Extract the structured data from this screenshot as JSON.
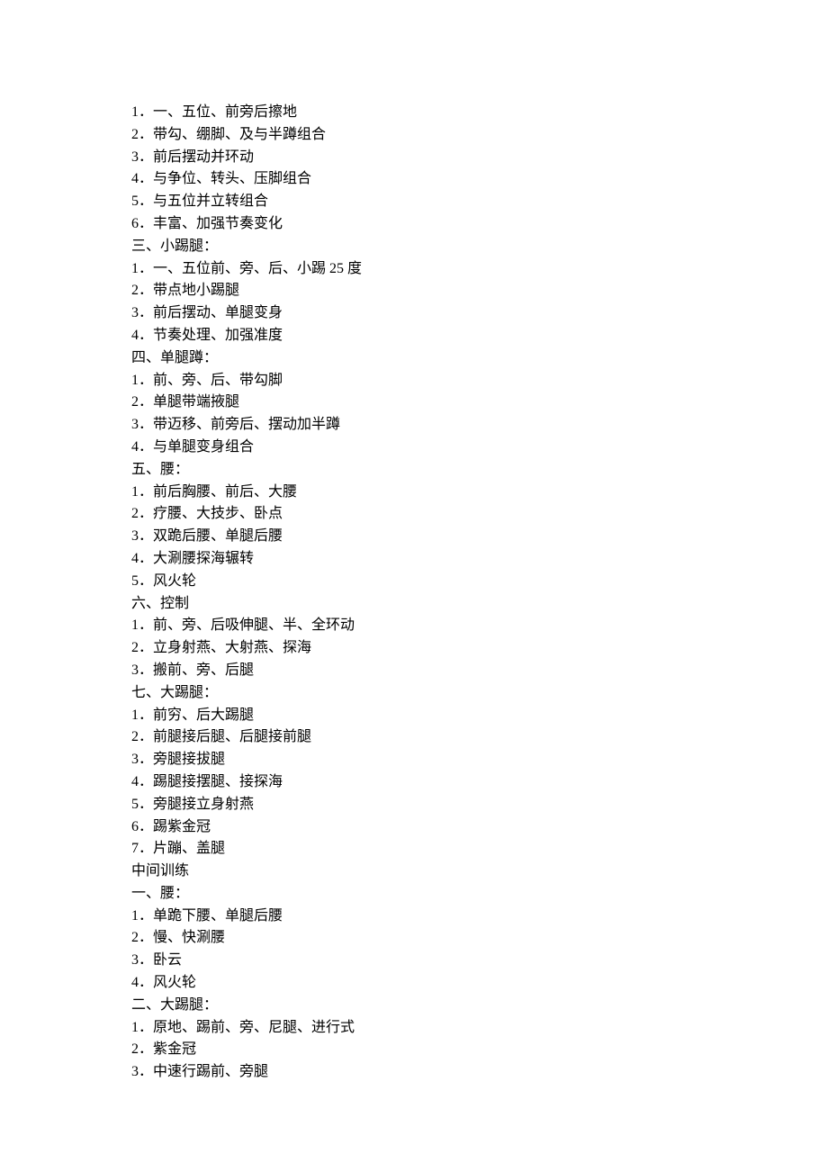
{
  "lines": [
    "1．一、五位、前旁后擦地",
    "2．带勾、绷脚、及与半蹲组合",
    "3．前后摆动并环动",
    "4．与争位、转头、压脚组合",
    "5．与五位并立转组合",
    "6．丰富、加强节奏变化",
    "三、小踢腿：",
    "1．一、五位前、旁、后、小踢 25 度",
    "2．带点地小踢腿",
    "3．前后摆动、单腿变身",
    "4．节奏处理、加强准度",
    "四、单腿蹲：",
    "1．前、旁、后、带勾脚",
    "2．单腿带端掖腿",
    "3．带迈移、前旁后、摆动加半蹲",
    "4．与单腿变身组合",
    "五、腰：",
    "1．前后胸腰、前后、大腰",
    "2．疗腰、大技步、卧点",
    "3．双跪后腰、单腿后腰",
    "4．大涮腰探海辗转",
    "5．风火轮",
    "六、控制",
    "1．前、旁、后吸伸腿、半、全环动",
    "2．立身射燕、大射燕、探海",
    "3．搬前、旁、后腿",
    "七、大踢腿：",
    "1．前穷、后大踢腿",
    "2．前腿接后腿、后腿接前腿",
    "3．旁腿接拔腿",
    "4．踢腿接摆腿、接探海",
    "5．旁腿接立身射燕",
    "6．踢紫金冠",
    "7．片蹦、盖腿",
    "中间训练",
    "一、腰：",
    "1．单跪下腰、单腿后腰",
    "2．慢、快涮腰",
    "3．卧云",
    "4．风火轮",
    "二、大踢腿：",
    "1．原地、踢前、旁、尼腿、进行式",
    "2．紫金冠",
    "3．中速行踢前、旁腿"
  ]
}
